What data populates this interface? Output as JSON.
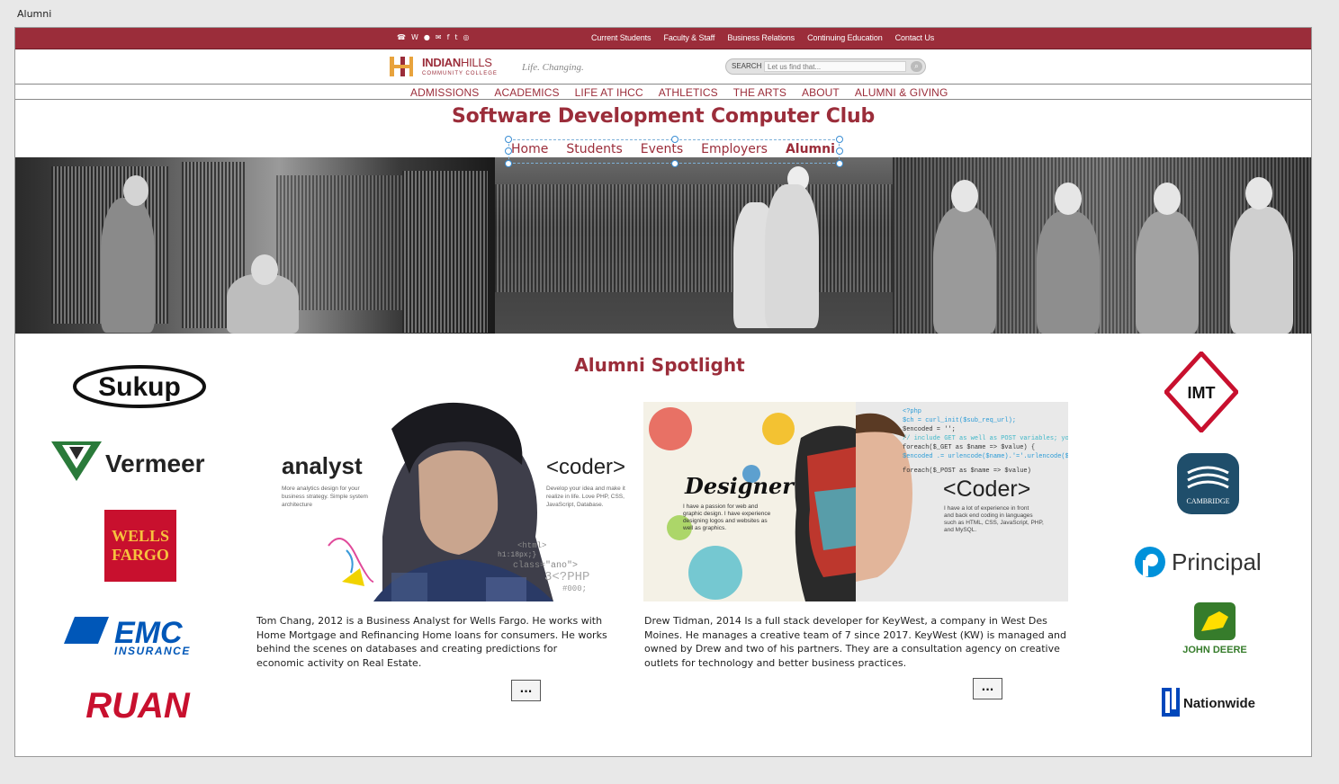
{
  "window": {
    "title": "Alumni"
  },
  "utility_bar": {
    "social_icons": [
      "phone-icon",
      "web-icon",
      "person-icon",
      "mail-icon",
      "facebook-icon",
      "twitter-icon",
      "instagram-icon"
    ],
    "links": [
      "Current Students",
      "Faculty & Staff",
      "Business Relations",
      "Continuing Education",
      "Contact Us"
    ]
  },
  "header": {
    "logo_line1_bold": "INDIAN",
    "logo_line1_rest": "HILLS",
    "logo_line2": "COMMUNITY COLLEGE",
    "tagline": "Life. Changing.",
    "search_label": "SEARCH",
    "search_placeholder": "Let us find that..."
  },
  "main_nav": [
    "ADMISSIONS",
    "ACADEMICS",
    "LIFE AT IHCC",
    "ATHLETICS",
    "THE ARTS",
    "ABOUT",
    "ALUMNI & GIVING"
  ],
  "club_title": "Software Development Computer Club",
  "sub_nav": [
    "Home",
    "Students",
    "Events",
    "Employers",
    "Alumni"
  ],
  "sub_nav_active": "Alumni",
  "spotlight": {
    "title": "Alumni Spotlight",
    "cards": [
      {
        "left_word": "analyst",
        "left_desc": "More analytics design for your business strategy. Simple system architecture",
        "right_word": "<coder>",
        "right_desc": "Develop your idea and make it realize in life. Love PHP, CSS, JavaScript, Database.",
        "text": "Tom Chang, 2012 is a Business Analyst for Wells Fargo. He works with Home Mortgage and Refinancing Home loans for consumers. He works behind the scenes on databases and creating predictions for economic activity on Real Estate.",
        "button": "..."
      },
      {
        "left_word": "Designer",
        "left_desc": "I have a passion for web and graphic design. I have experience designing logos and websites as well as graphics.",
        "right_word": "<Coder>",
        "right_desc": "I have a lot of experience in front and back end coding in languages such as HTML, CSS, JavaScript, PHP, and MySQL.",
        "text": "Drew Tidman, 2014 Is a full stack developer for KeyWest, a company in West Des Moines. He manages a creative team of 7 since 2017. KeyWest (KW) is managed and owned by Drew and two of his partners. They are a consultation agency on creative outlets for technology and better business  practices.",
        "button": "..."
      }
    ]
  },
  "left_logos": [
    "Sukup",
    "Vermeer",
    "WELLS FARGO",
    "EMC INSURANCE",
    "RUAN"
  ],
  "right_logos": [
    "IMT",
    "CAMBRIDGE",
    "Principal",
    "JOHN DEERE",
    "Nationwide"
  ],
  "colors": {
    "brand": "#9b2d3a",
    "selection": "#3a8ed4"
  }
}
